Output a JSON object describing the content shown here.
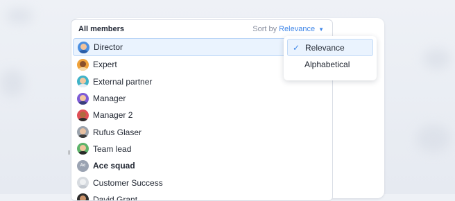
{
  "list": {
    "title": "All members",
    "sort_prefix": "Sort by",
    "sort_value": "Relevance",
    "items": [
      {
        "label": "Director",
        "avatar": "director-avatar",
        "bg": "#4b8fe0",
        "skin": "#f2c39b",
        "shirt": "#2b5ea8",
        "selected": true
      },
      {
        "label": "Expert",
        "avatar": "expert-avatar",
        "bg": "#f0a23a",
        "skin": "#8a4f2a",
        "shirt": "#f6d9a8"
      },
      {
        "label": "External partner",
        "avatar": "external-partner-avatar",
        "bg": "#3fb3c8",
        "skin": "#f1c7a0",
        "shirt": "#e9eef4"
      },
      {
        "label": "Manager",
        "avatar": "manager-avatar",
        "bg": "#7d5bd6",
        "skin": "#f3c6a0",
        "shirt": "#3a3f7a"
      },
      {
        "label": "Manager 2",
        "avatar": "manager-2-avatar",
        "bg": "#e04f57",
        "skin": "#b06a3e",
        "shirt": "#2d2d2d"
      },
      {
        "label": "Rufus Glaser",
        "avatar": "rufus-glaser-avatar",
        "bg": "#9ba3ad",
        "skin": "#e8c1a2",
        "shirt": "#3b3b3b"
      },
      {
        "label": "Team lead",
        "avatar": "team-lead-avatar",
        "bg": "#5db36a",
        "skin": "#f0c49c",
        "shirt": "#2a2a2a"
      },
      {
        "label": "Ace squad",
        "avatar": "ace-squad-avatar",
        "initials": "Ac",
        "bold": true
      },
      {
        "label": "Customer Success",
        "avatar": "customer-success-avatar",
        "bg": "#d7dbe0",
        "skin": "#eef0f2",
        "shirt": "#c3c8cf"
      },
      {
        "label": "David Grant",
        "avatar": "david-grant-avatar",
        "bg": "#2d2d2d",
        "skin": "#c9926a",
        "shirt": "#1a1a1a"
      }
    ]
  },
  "dropdown": {
    "options": [
      {
        "label": "Relevance",
        "active": true
      },
      {
        "label": "Alphabetical",
        "active": false
      }
    ]
  },
  "colors": {
    "accent": "#3f86e8",
    "selected_bg": "#eaf3fe"
  }
}
